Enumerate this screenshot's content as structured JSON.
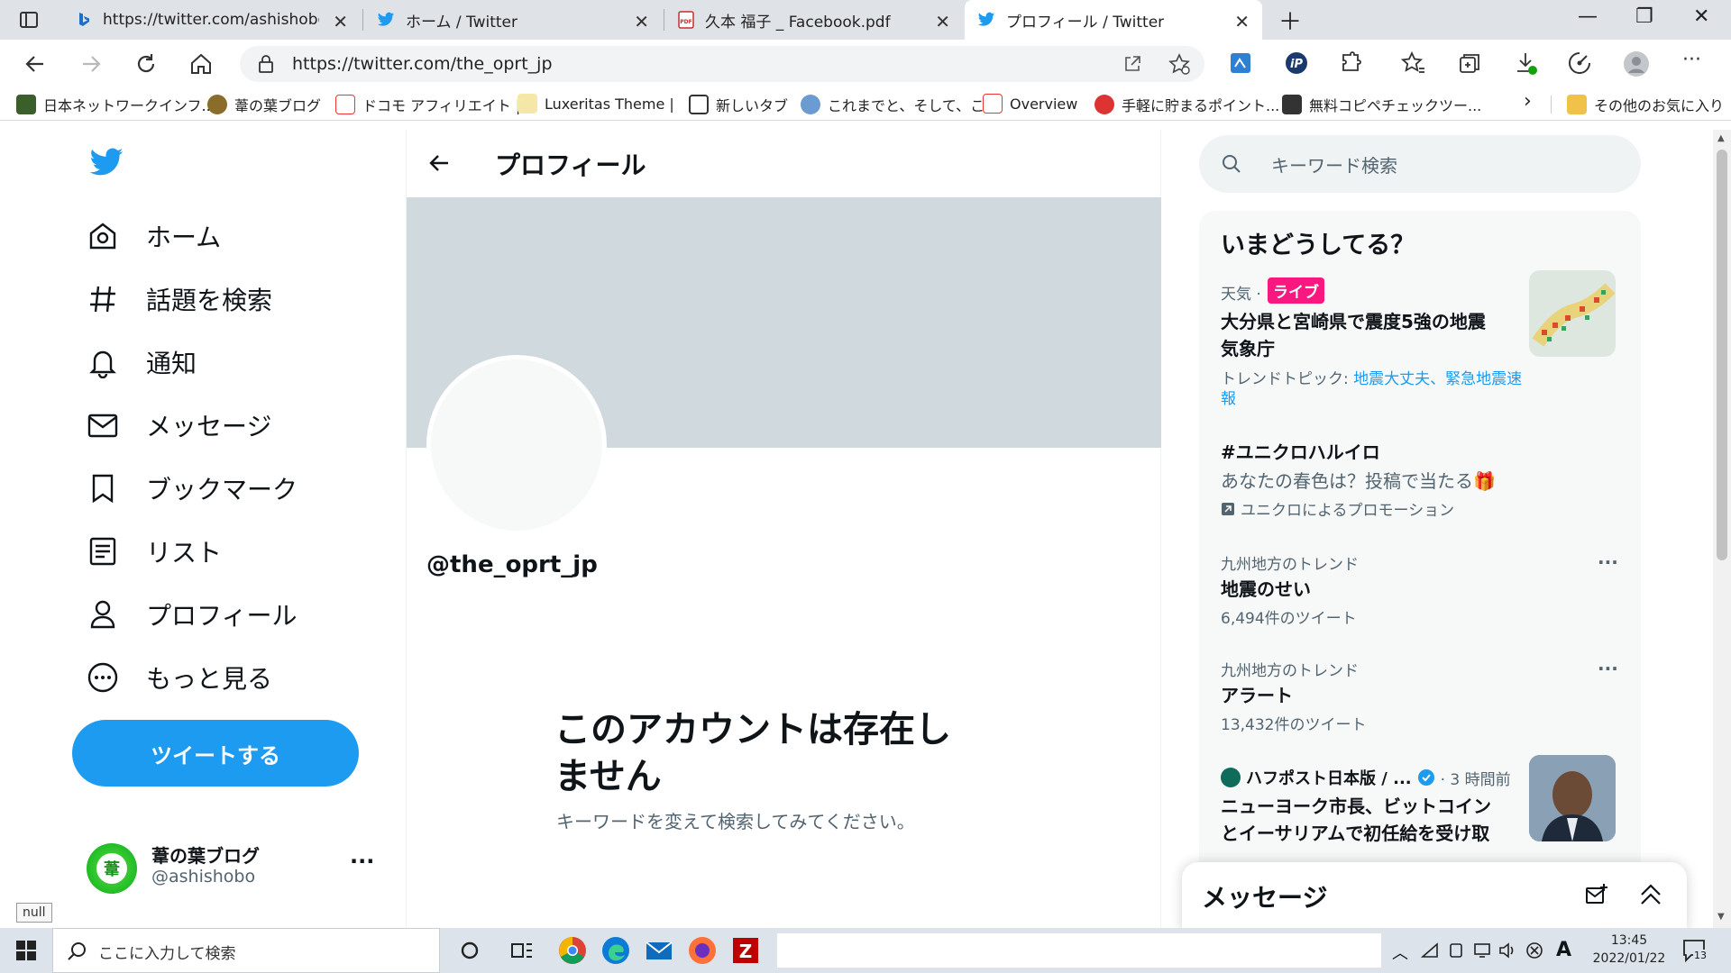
{
  "browser": {
    "tabs": [
      {
        "title": "https://twitter.com/ashishobo - E",
        "icon": "bing-icon",
        "active": false
      },
      {
        "title": "ホーム / Twitter",
        "icon": "twitter-icon",
        "active": false
      },
      {
        "title": "久本 福子 _ Facebook.pdf",
        "icon": "pdf-icon",
        "active": false
      },
      {
        "title": "プロフィール / Twitter",
        "icon": "twitter-icon",
        "active": true
      }
    ],
    "url": "https://twitter.com/the_oprt_jp",
    "bookmarks": [
      "日本ネットワークインフ...",
      "葦の葉ブログ",
      "ドコモ アフィリエイト |...",
      "Luxeritas Theme |",
      "新しいタブ",
      "これまでと、そして、こ...",
      "Overview",
      "手軽に貯まるポイント...",
      "無料コピペチェックツー..."
    ],
    "bookmarks_other": "その他のお気に入り",
    "tooltip": "null"
  },
  "nav": {
    "items": [
      "ホーム",
      "話題を検索",
      "通知",
      "メッセージ",
      "ブックマーク",
      "リスト",
      "プロフィール",
      "もっと見る"
    ],
    "tweet_button": "ツイートする",
    "account_name": "葦の葉ブログ",
    "account_handle": "@ashishobo",
    "account_avatar_char": "葦"
  },
  "main": {
    "header_title": "プロフィール",
    "handle": "@the_oprt_jp",
    "empty_title": "このアカウントは存在し\nません",
    "empty_sub": "キーワードを変えて検索してみてください。"
  },
  "sidebar": {
    "search_placeholder": "キーワード検索",
    "trends_title": "いまどうしてる？",
    "trend1": {
      "category": "天気 · ",
      "live": "ライブ",
      "title": "大分県と宮崎県で震度5強の地震\n気象庁",
      "topic_prefix": "トレンドトピック: ",
      "topic_links": "地震大丈夫、緊急地震速報"
    },
    "trend2": {
      "title": "#ユニクロハルイロ",
      "desc": "あなたの春色は？投稿で当たる🎁",
      "promo": "ユニクロによるプロモーション"
    },
    "trend3": {
      "context": "九州地方のトレンド",
      "title": "地震のせい",
      "count": "6,494件のツイート"
    },
    "trend4": {
      "context": "九州地方のトレンド",
      "title": "アラート",
      "count": "13,432件のツイート"
    },
    "trend5": {
      "source": "ハフポスト日本版 / ...",
      "time": "· 3 時間前",
      "title": "ニューヨーク市長、ビットコイン\nとイーサリアムで初任給を受け取"
    },
    "messages_title": "メッセージ"
  },
  "taskbar": {
    "search_placeholder": "ここに入力して検索",
    "time": "13:45",
    "date": "2022/01/22",
    "notification_count": "13"
  },
  "colors": {
    "twitter_blue": "#1d9bf0",
    "live_pink": "#f91880",
    "banner": "#cfd9de"
  }
}
